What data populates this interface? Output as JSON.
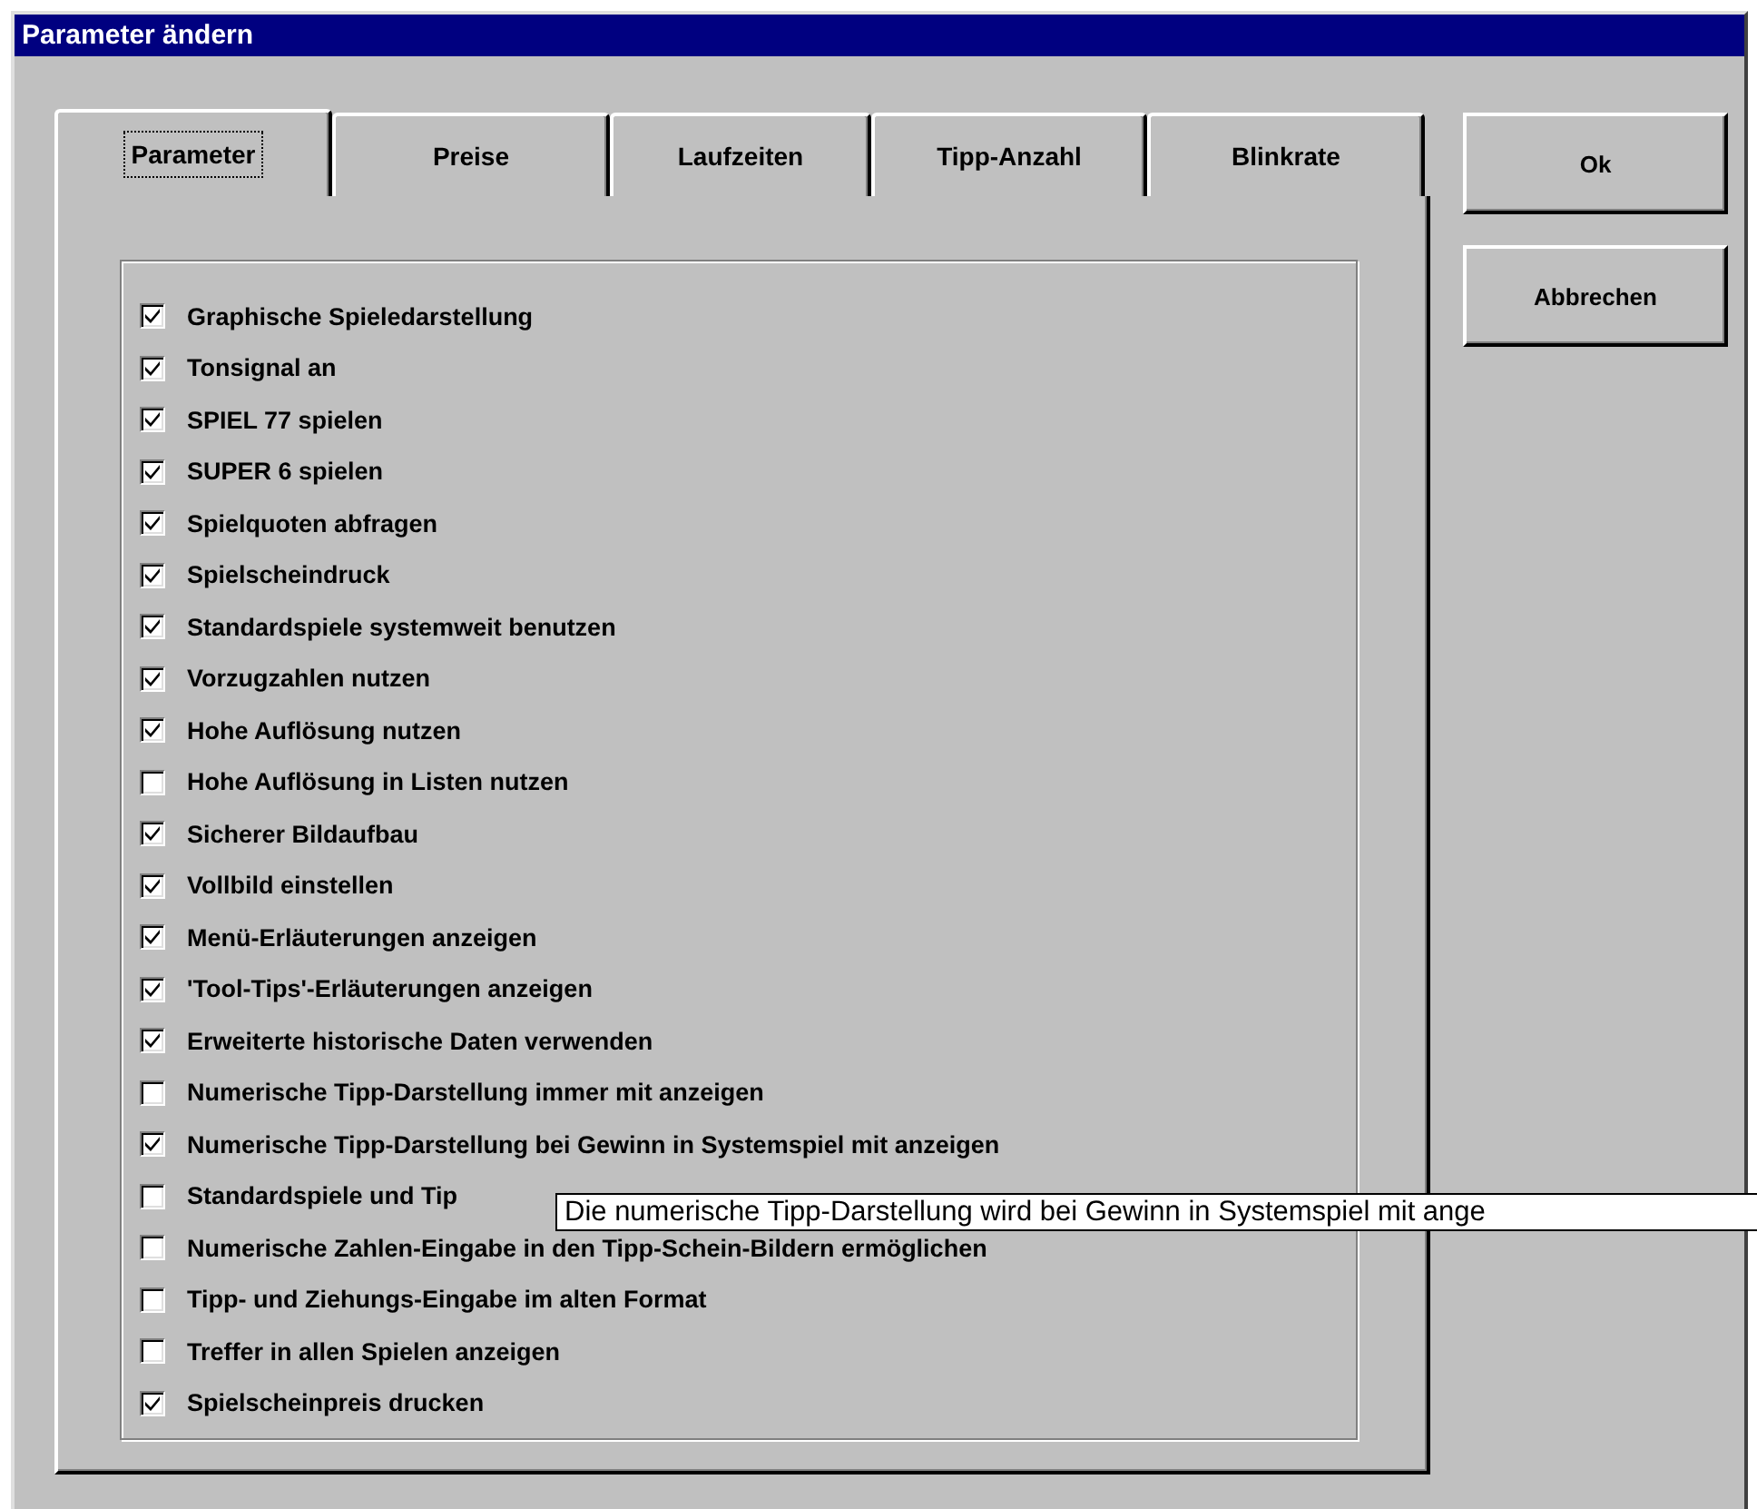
{
  "window": {
    "title": "Parameter ändern"
  },
  "tabs": [
    {
      "label": "Parameter",
      "selected": true
    },
    {
      "label": "Preise",
      "selected": false
    },
    {
      "label": "Laufzeiten",
      "selected": false
    },
    {
      "label": "Tipp-Anzahl",
      "selected": false
    },
    {
      "label": "Blinkrate",
      "selected": false
    }
  ],
  "options": [
    {
      "label": "Graphische Spieledarstellung",
      "checked": true
    },
    {
      "label": "Tonsignal an",
      "checked": true
    },
    {
      "label": "SPIEL 77 spielen",
      "checked": true
    },
    {
      "label": "SUPER 6 spielen",
      "checked": true
    },
    {
      "label": "Spielquoten abfragen",
      "checked": true
    },
    {
      "label": "Spielscheindruck",
      "checked": true
    },
    {
      "label": "Standardspiele systemweit benutzen",
      "checked": true
    },
    {
      "label": "Vorzugzahlen nutzen",
      "checked": true
    },
    {
      "label": "Hohe Auflösung nutzen",
      "checked": true
    },
    {
      "label": "Hohe Auflösung in Listen nutzen",
      "checked": false
    },
    {
      "label": "Sicherer Bildaufbau",
      "checked": true
    },
    {
      "label": "Vollbild einstellen",
      "checked": true
    },
    {
      "label": "Menü-Erläuterungen anzeigen",
      "checked": true
    },
    {
      "label": "'Tool-Tips'-Erläuterungen anzeigen",
      "checked": true
    },
    {
      "label": "Erweiterte historische Daten verwenden",
      "checked": true
    },
    {
      "label": "Numerische Tipp-Darstellung immer mit anzeigen",
      "checked": false
    },
    {
      "label": "Numerische Tipp-Darstellung bei Gewinn in Systemspiel mit anzeigen",
      "checked": true
    },
    {
      "label": "Standardspiele und Tip",
      "checked": false
    },
    {
      "label": "Numerische Zahlen-Eingabe in den Tipp-Schein-Bildern ermöglichen",
      "checked": false
    },
    {
      "label": "Tipp- und Ziehungs-Eingabe im alten Format",
      "checked": false
    },
    {
      "label": "Treffer in allen Spielen anzeigen",
      "checked": false
    },
    {
      "label": "Spielscheinpreis drucken",
      "checked": true
    }
  ],
  "buttons": [
    "Ok",
    "Abbrechen"
  ],
  "tooltip": "Die numerische Tipp-Darstellung wird bei Gewinn in Systemspiel mit ange"
}
